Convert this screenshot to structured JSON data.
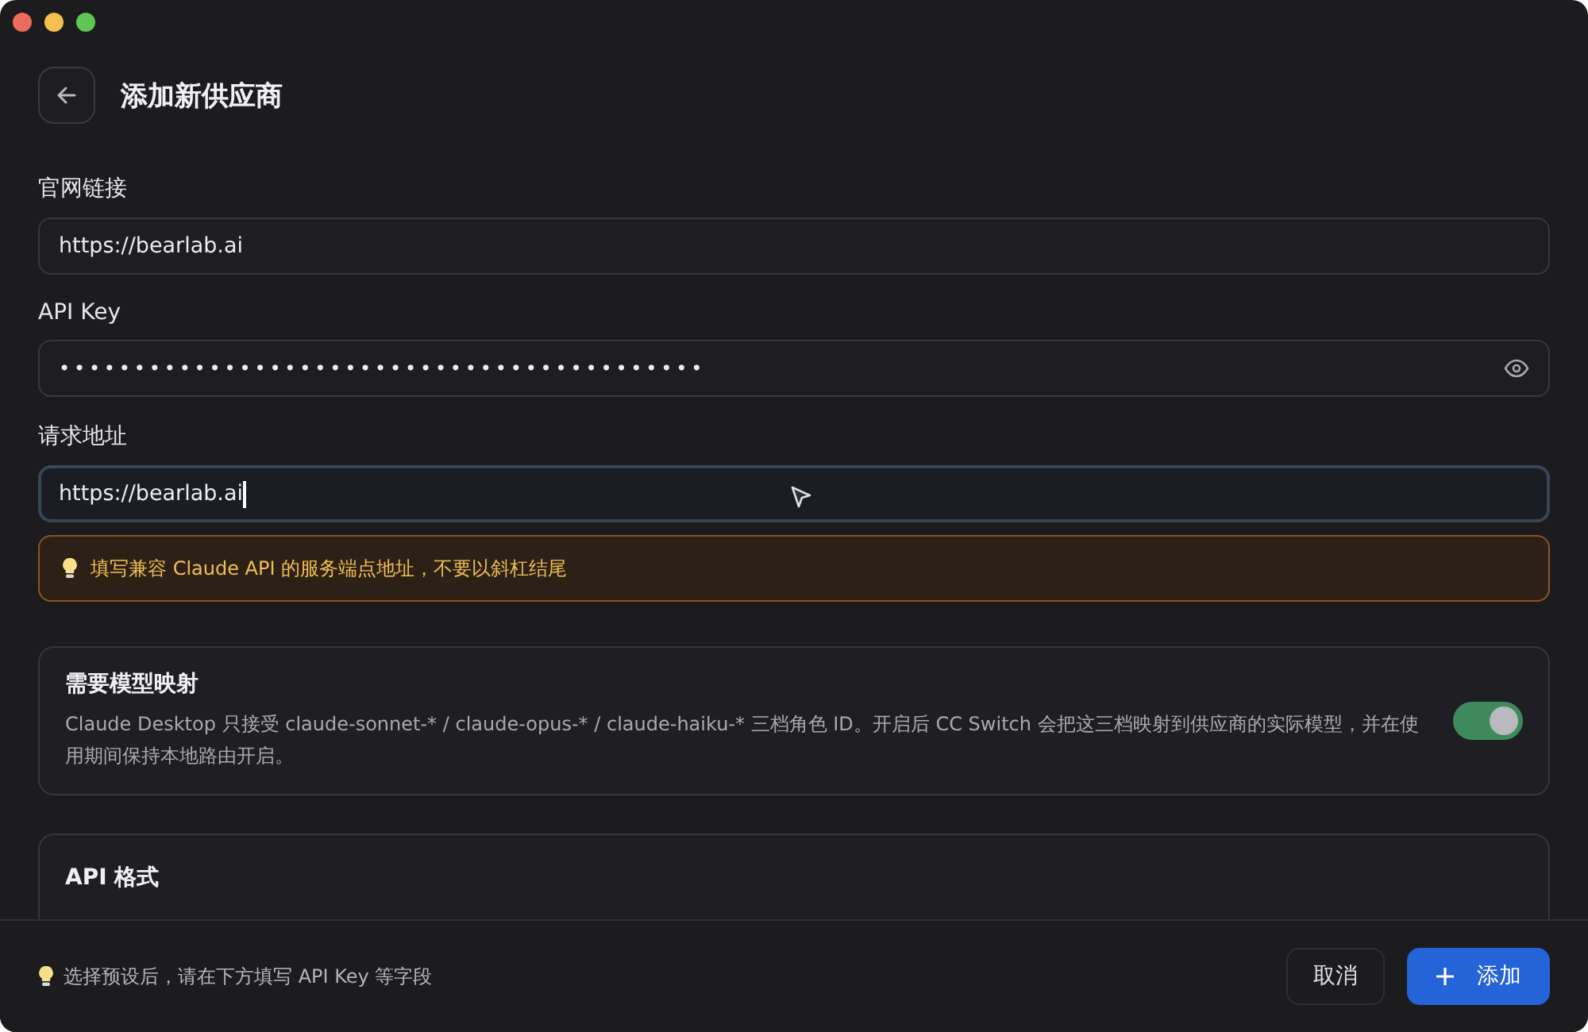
{
  "header": {
    "title": "添加新供应商"
  },
  "fields": [
    {
      "kind": "text",
      "label": "官网链接",
      "value": "https://bearlab.ai",
      "focused": false
    },
    {
      "kind": "secret",
      "label": "API Key",
      "value": "•••••••••••••••••••••••••••••••••••••••••••",
      "focused": false
    },
    {
      "kind": "text",
      "label": "请求地址",
      "value": "https://bearlab.ai",
      "focused": true,
      "hint": "填写兼容 Claude API 的服务端点地址，不要以斜杠结尾"
    }
  ],
  "mapping": {
    "title": "需要模型映射",
    "description": "Claude Desktop 只接受 claude-sonnet-* / claude-opus-* / claude-haiku-* 三档角色 ID。开启后 CC Switch 会把这三档映射到供应商的实际模型，并在使用期间保持本地路由开启。",
    "on": true
  },
  "api_format": {
    "title": "API 格式"
  },
  "footer": {
    "tip": "选择预设后，请在下方填写 API Key 等字段",
    "buttons": [
      {
        "kind": "secondary",
        "label": "取消"
      },
      {
        "kind": "primary",
        "label": "添加"
      }
    ]
  }
}
